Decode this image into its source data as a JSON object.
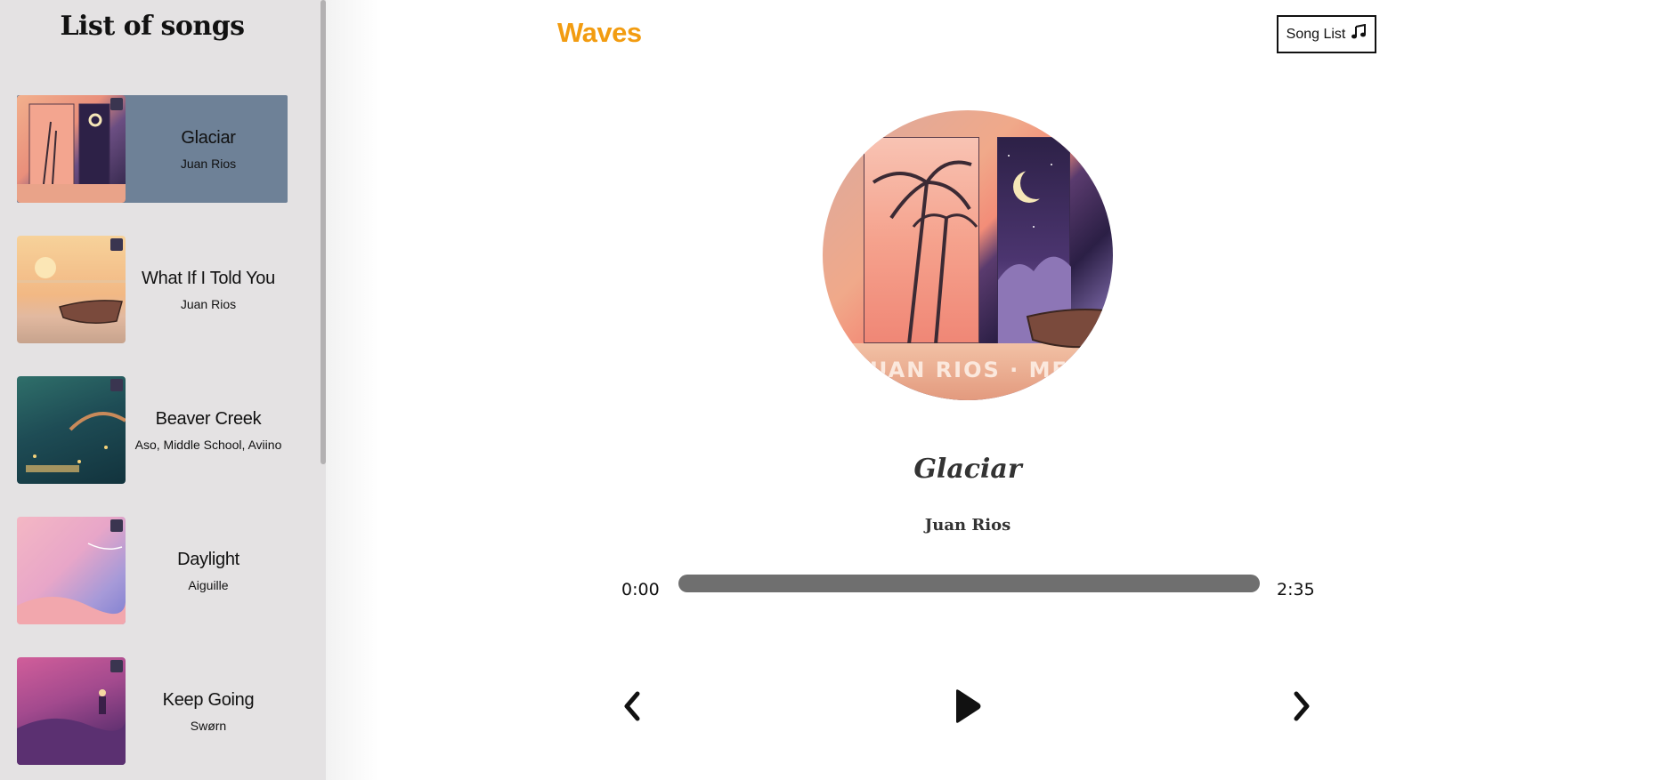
{
  "sidebar": {
    "title": "List of songs",
    "songs": [
      {
        "title": "Glaciar",
        "artist": "Juan Rios",
        "active": true
      },
      {
        "title": "What If I Told You",
        "artist": "Juan Rios",
        "active": false
      },
      {
        "title": "Beaver Creek",
        "artist": "Aso, Middle School, Aviino",
        "active": false
      },
      {
        "title": "Daylight",
        "artist": "Aiguille",
        "active": false
      },
      {
        "title": "Keep Going",
        "artist": "Swørn",
        "active": false
      }
    ]
  },
  "header": {
    "logo": "Waves",
    "song_list_label": "Song List",
    "song_list_icon": "music-note-icon"
  },
  "player": {
    "cover_text": "JUAN RIOS · MERAKI",
    "title": "Glaciar",
    "artist": "Juan Rios",
    "current_time": "0:00",
    "total_time": "2:35",
    "progress": 0,
    "controls": {
      "prev_icon": "chevron-left-icon",
      "play_icon": "play-icon",
      "next_icon": "chevron-right-icon"
    }
  },
  "colors": {
    "accent": "#f29c11",
    "active_item": "#6e8197",
    "sidebar_bg": "#e4e2e3",
    "progress_track": "#6f6f6f"
  }
}
